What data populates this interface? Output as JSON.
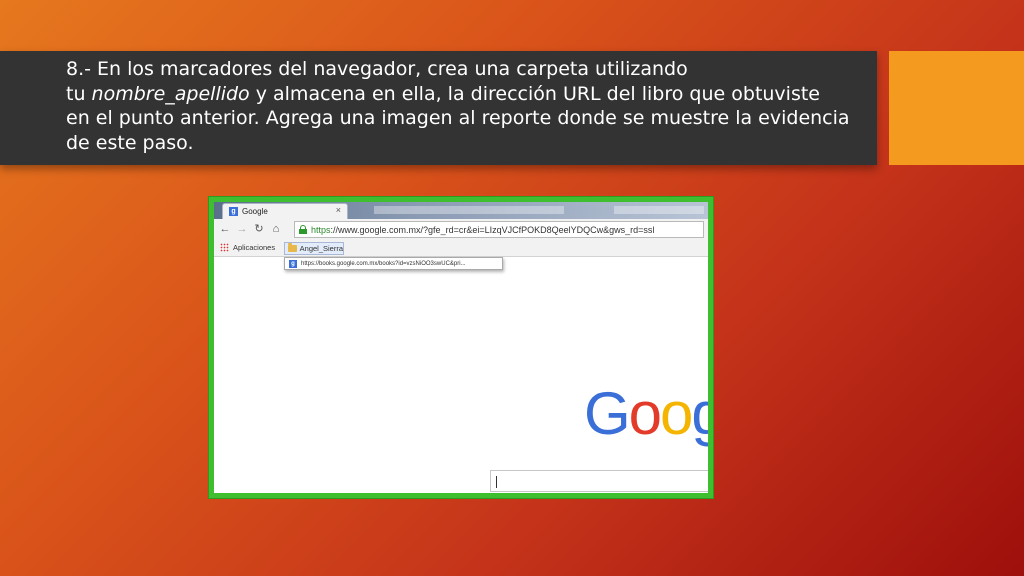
{
  "slide": {
    "title_line1": "8.- En los marcadores del navegador, crea una carpeta utilizando",
    "title_line2_prefix": "tu ",
    "title_line2_italic": "nombre_apellido",
    "title_line2_suffix": " y almacena en ella, la dirección URL del libro que obtuviste",
    "title_line3": "en el punto anterior. Agrega una imagen al reporte donde se muestre la evidencia",
    "title_line4": "de este paso."
  },
  "browser": {
    "tab_title": "Google",
    "tab_close": "×",
    "url_scheme": "https",
    "url_rest": "://www.google.com.mx/?gfe_rd=cr&ei=LIzqVJCfPOKD8QeelYDQCw&gws_rd=ssl",
    "bookmarks": {
      "apps_label": "Aplicaciones",
      "folder_label": "Angel_Sierra"
    },
    "dropdown_item": "https://books.google.com.mx/books?id=vzsNiOO3swUC&pri...",
    "logo_text": [
      "G",
      "o",
      "o",
      "g"
    ]
  },
  "colors": {
    "title_bar": "#333333",
    "accent_box": "#f39a1f",
    "frame_border": "#3fbf2f"
  }
}
